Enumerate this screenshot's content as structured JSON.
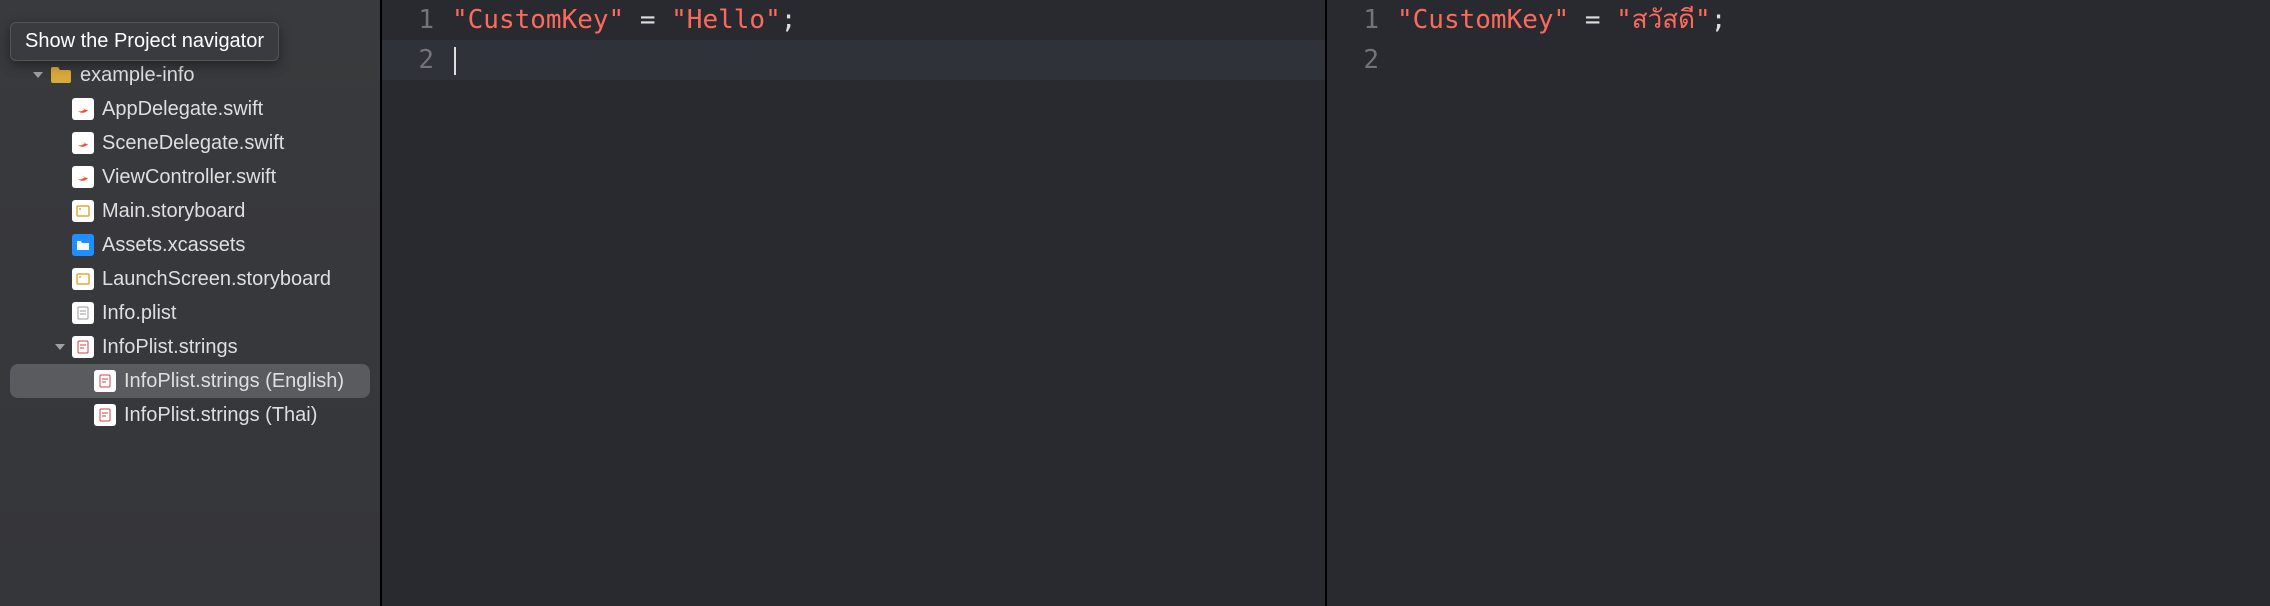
{
  "tooltip": "Show the Project navigator",
  "tree": {
    "root": {
      "label": "example-info",
      "expanded": true
    },
    "items": [
      {
        "label": "AppDelegate.swift",
        "icon": "swift",
        "indent": 2
      },
      {
        "label": "SceneDelegate.swift",
        "icon": "swift",
        "indent": 2
      },
      {
        "label": "ViewController.swift",
        "icon": "swift",
        "indent": 2
      },
      {
        "label": "Main.storyboard",
        "icon": "storyboard",
        "indent": 2
      },
      {
        "label": "Assets.xcassets",
        "icon": "xcassets",
        "indent": 2
      },
      {
        "label": "LaunchScreen.storyboard",
        "icon": "storyboard",
        "indent": 2
      },
      {
        "label": "Info.plist",
        "icon": "plist",
        "indent": 2
      },
      {
        "label": "InfoPlist.strings",
        "icon": "strings",
        "indent": 2,
        "expanded": true
      },
      {
        "label": "InfoPlist.strings (English)",
        "icon": "strings",
        "indent": 3,
        "selected": true
      },
      {
        "label": "InfoPlist.strings (Thai)",
        "icon": "strings",
        "indent": 3
      }
    ]
  },
  "editors": [
    {
      "lines": [
        {
          "n": "1",
          "key": "\"CustomKey\"",
          "op": " = ",
          "val": "\"Hello\"",
          "end": ";"
        },
        {
          "n": "2",
          "current": true,
          "cursor": true
        }
      ]
    },
    {
      "lines": [
        {
          "n": "1",
          "key": "\"CustomKey\"",
          "op": " = ",
          "val": "\"สวัสดี\"",
          "end": ";"
        },
        {
          "n": "2"
        }
      ]
    }
  ]
}
